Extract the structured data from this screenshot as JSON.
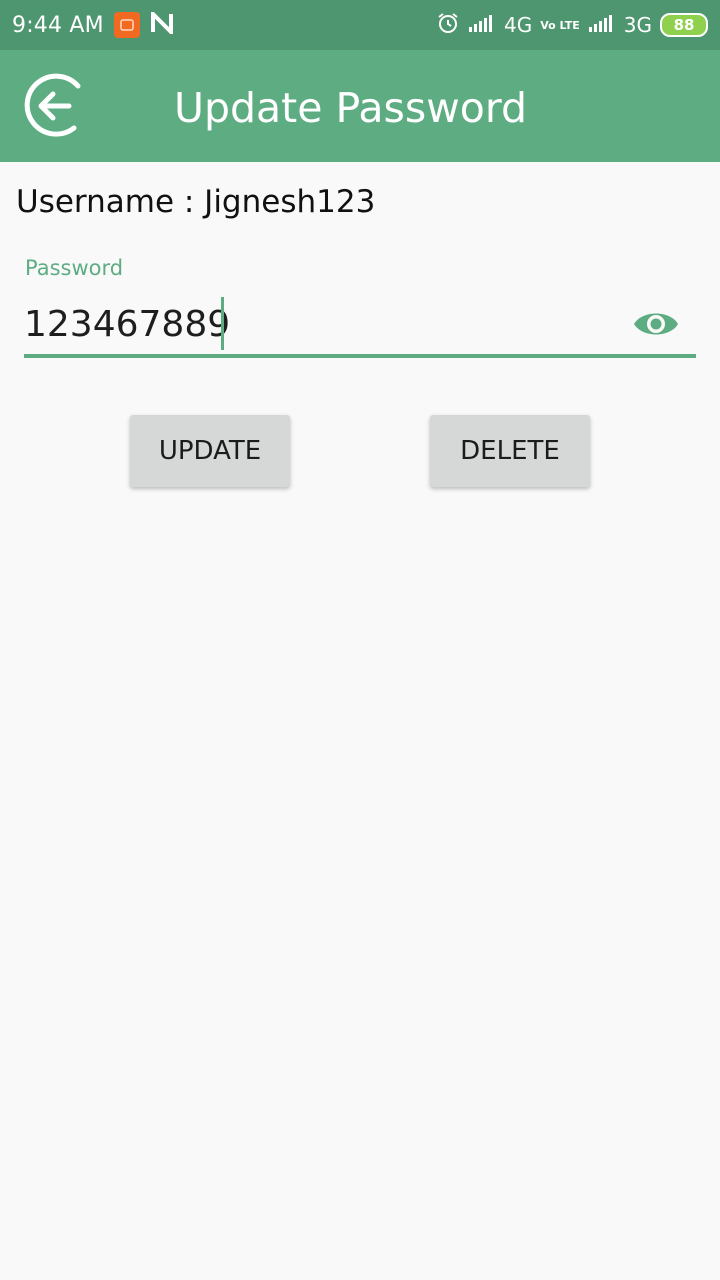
{
  "status_bar": {
    "time": "9:44 AM",
    "app_icon": "orange-app-icon",
    "n_icon": "n-logo-icon",
    "alarm_icon": "alarm-icon",
    "network1": "4G",
    "volte": "Vo LTE",
    "network2": "3G",
    "battery": "88",
    "colors": {
      "background": "#4e9670",
      "battery": "#8fd14f"
    }
  },
  "app_bar": {
    "back_icon": "back-arrow-icon",
    "title": "Update Password",
    "color": "#5ead82"
  },
  "form": {
    "username_text": "Username : Jignesh123",
    "password_label": "Password",
    "password_value": "123467889",
    "visibility_icon": "eye-icon",
    "accent": "#5ead82"
  },
  "actions": {
    "update_label": "UPDATE",
    "delete_label": "DELETE"
  }
}
